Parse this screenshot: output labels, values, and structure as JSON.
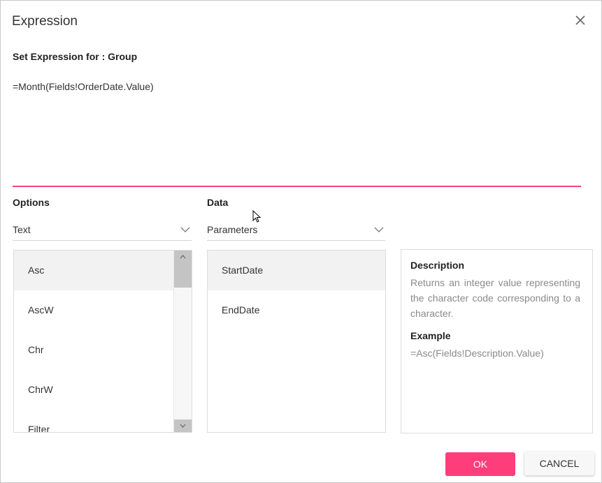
{
  "dialog": {
    "title": "Expression",
    "close_icon": "close-icon",
    "subtitle": "Set Expression for : Group",
    "expression_value": "=Month(Fields!OrderDate.Value)",
    "accent_color": "#f0467b"
  },
  "options": {
    "label": "Options",
    "selected": "Text",
    "items": [
      "Asc",
      "AscW",
      "Chr",
      "ChrW",
      "Filter"
    ],
    "selected_item": "Asc"
  },
  "data_panel": {
    "label": "Data",
    "selected": "Parameters",
    "items": [
      "StartDate",
      "EndDate"
    ],
    "selected_item": "StartDate"
  },
  "description": {
    "heading": "Description",
    "text": "Returns an integer value representing the character code corresponding to a character.",
    "example_heading": "Example",
    "example_text": "=Asc(Fields!Description.Value)"
  },
  "footer": {
    "ok_label": "OK",
    "cancel_label": "CANCEL",
    "ok_color": "#fd3e7a"
  }
}
